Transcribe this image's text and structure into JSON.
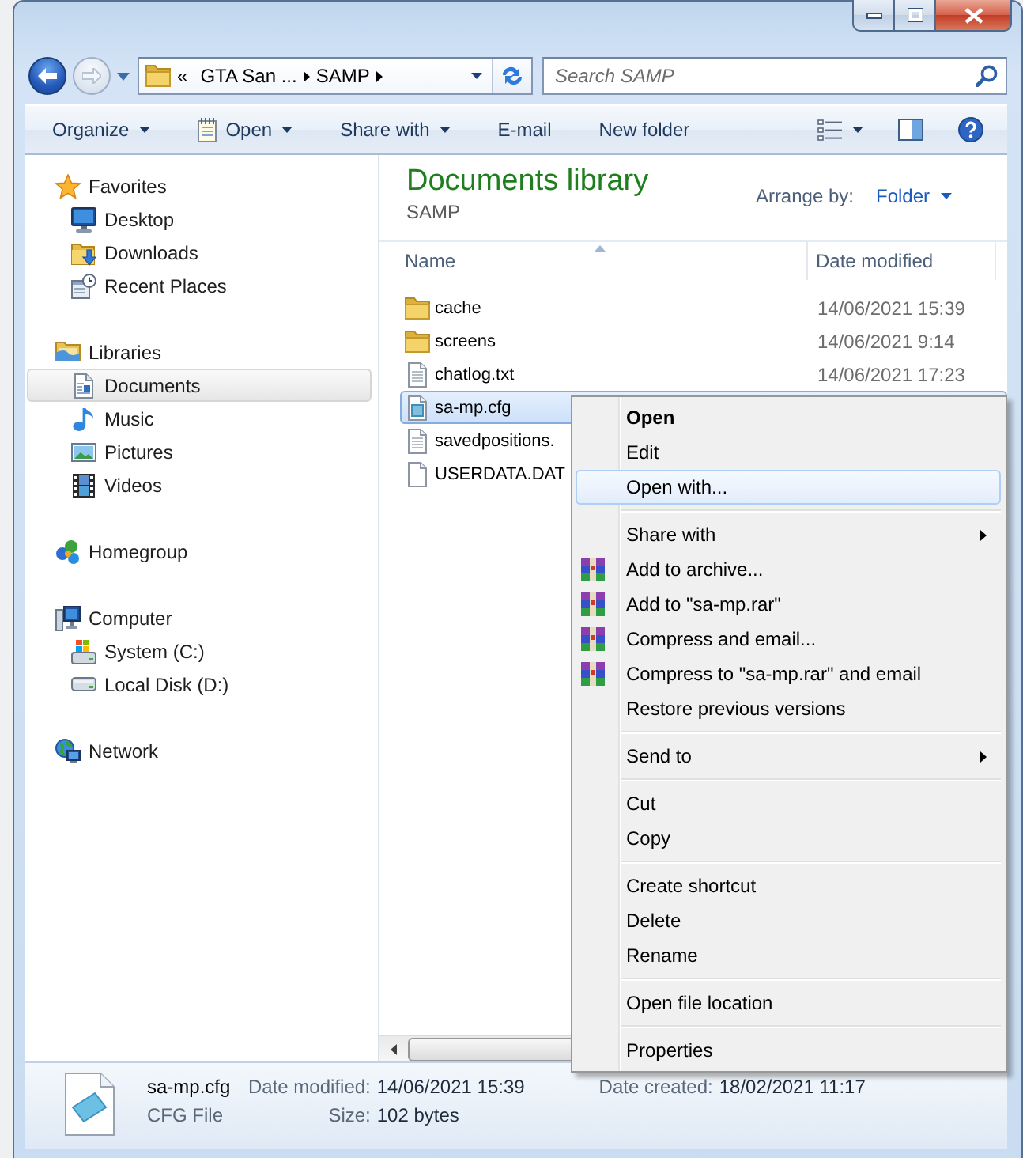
{
  "navigation": {
    "back": {
      "disabled": false
    },
    "forward": {
      "disabled": true
    }
  },
  "address_bar": {
    "overflow": "«",
    "crumbs": [
      "GTA San ...",
      "SAMP"
    ]
  },
  "search": {
    "placeholder": "Search SAMP"
  },
  "toolbar": {
    "buttons": [
      {
        "label": "Organize",
        "kind": "menu"
      },
      {
        "label": "Open",
        "kind": "icon_menu"
      },
      {
        "label": "Share with",
        "kind": "menu"
      },
      {
        "label": "E-mail",
        "kind": "command"
      },
      {
        "label": "New folder",
        "kind": "command"
      }
    ]
  },
  "sidebar": {
    "items": [
      {
        "label": "Favorites",
        "selected": false,
        "children": [
          {
            "label": "Desktop",
            "selected": false
          },
          {
            "label": "Downloads",
            "selected": false
          },
          {
            "label": "Recent Places",
            "selected": false
          }
        ]
      },
      {
        "label": "Libraries",
        "selected": false,
        "children": [
          {
            "label": "Documents",
            "selected": true
          },
          {
            "label": "Music",
            "selected": false
          },
          {
            "label": "Pictures",
            "selected": false
          },
          {
            "label": "Videos",
            "selected": false
          }
        ]
      },
      {
        "label": "Homegroup",
        "selected": false
      },
      {
        "label": "Computer",
        "selected": false,
        "children": [
          {
            "label": "System (C:)",
            "selected": false
          },
          {
            "label": "Local Disk (D:)",
            "selected": false
          }
        ]
      },
      {
        "label": "Network",
        "selected": false
      }
    ]
  },
  "library": {
    "title": "Documents library",
    "subtitle": "SAMP",
    "arrange_label": "Arrange by:",
    "arrange_value": "Folder"
  },
  "file_list": {
    "columns": [
      {
        "label": "Name",
        "sorted": true
      },
      {
        "label": "Date modified",
        "sorted": false
      }
    ],
    "rows": [
      {
        "name": "cache",
        "kind": "folder",
        "date_modified": "14/06/2021 15:39",
        "selected": false
      },
      {
        "name": "screens",
        "kind": "folder",
        "date_modified": "14/06/2021 9:14",
        "selected": false
      },
      {
        "name": "chatlog.txt",
        "kind": "text",
        "date_modified": "14/06/2021 17:23",
        "selected": false
      },
      {
        "name": "sa-mp.cfg",
        "kind": "config",
        "selected": true
      },
      {
        "name": "savedpositions.",
        "kind": "text",
        "selected": false
      },
      {
        "name": "USERDATA.DAT",
        "kind": "file",
        "selected": false
      }
    ]
  },
  "context_menu": {
    "groups": [
      {
        "items": [
          {
            "label": "Open",
            "kind": "plain",
            "default": true,
            "selected": false,
            "submenu": false
          },
          {
            "label": "Edit",
            "kind": "plain",
            "default": false,
            "selected": false,
            "submenu": false
          },
          {
            "label": "Open with...",
            "kind": "plain",
            "default": false,
            "selected": true,
            "submenu": false
          }
        ]
      },
      {
        "items": [
          {
            "label": "Share with",
            "kind": "plain",
            "default": false,
            "selected": false,
            "submenu": true
          },
          {
            "label": "Add to archive...",
            "kind": "archive",
            "default": false,
            "selected": false,
            "submenu": false
          },
          {
            "label": "Add to \"sa-mp.rar\"",
            "kind": "archive",
            "default": false,
            "selected": false,
            "submenu": false
          },
          {
            "label": "Compress and email...",
            "kind": "archive",
            "default": false,
            "selected": false,
            "submenu": false
          },
          {
            "label": "Compress to \"sa-mp.rar\" and email",
            "kind": "archive",
            "default": false,
            "selected": false,
            "submenu": false
          },
          {
            "label": "Restore previous versions",
            "kind": "plain",
            "default": false,
            "selected": false,
            "submenu": false
          }
        ]
      },
      {
        "items": [
          {
            "label": "Send to",
            "kind": "plain",
            "default": false,
            "selected": false,
            "submenu": true
          }
        ]
      },
      {
        "items": [
          {
            "label": "Cut",
            "kind": "plain",
            "default": false,
            "selected": false,
            "submenu": false
          },
          {
            "label": "Copy",
            "kind": "plain",
            "default": false,
            "selected": false,
            "submenu": false
          }
        ]
      },
      {
        "items": [
          {
            "label": "Create shortcut",
            "kind": "plain",
            "default": false,
            "selected": false,
            "submenu": false
          },
          {
            "label": "Delete",
            "kind": "plain",
            "default": false,
            "selected": false,
            "submenu": false
          },
          {
            "label": "Rename",
            "kind": "plain",
            "default": false,
            "selected": false,
            "submenu": false
          }
        ]
      },
      {
        "items": [
          {
            "label": "Open file location",
            "kind": "plain",
            "default": false,
            "selected": false,
            "submenu": false
          }
        ]
      },
      {
        "items": [
          {
            "label": "Properties",
            "kind": "plain",
            "default": false,
            "selected": false,
            "submenu": false
          }
        ]
      }
    ]
  },
  "details": {
    "name": "sa-mp.cfg",
    "type": "CFG File",
    "columns": [
      [
        {
          "label": "Date modified:",
          "value": "14/06/2021 15:39"
        },
        {
          "label": "Size:",
          "value": "102 bytes"
        }
      ],
      [
        {
          "label": "Date created:",
          "value": "18/02/2021 11:17"
        }
      ]
    ]
  }
}
